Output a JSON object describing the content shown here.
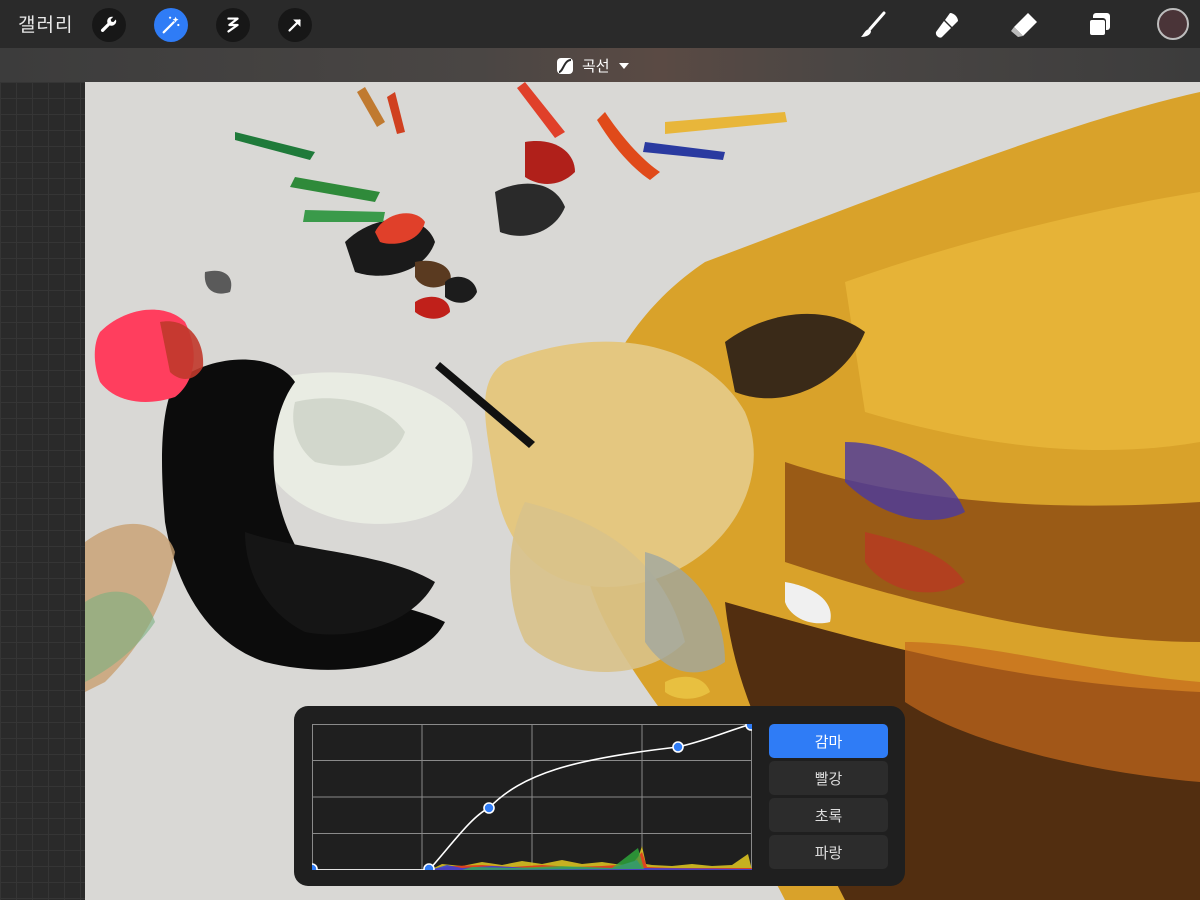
{
  "toolbar": {
    "gallery_label": "갤러리",
    "left_tools": [
      "wrench-icon",
      "magic-wand-icon",
      "selection-icon",
      "transform-arrow-icon"
    ],
    "active_tool": "magic-wand-icon",
    "right_tools": [
      "brush-icon",
      "smudge-icon",
      "eraser-icon",
      "layers-icon"
    ],
    "color_swatch": "#4a3438"
  },
  "adjustment": {
    "mode_label": "곡선"
  },
  "curves": {
    "channels": [
      {
        "label": "감마",
        "active": true
      },
      {
        "label": "빨강",
        "active": false
      },
      {
        "label": "초록",
        "active": false
      },
      {
        "label": "파랑",
        "active": false
      }
    ],
    "accent_color": "#2f7cf6"
  }
}
